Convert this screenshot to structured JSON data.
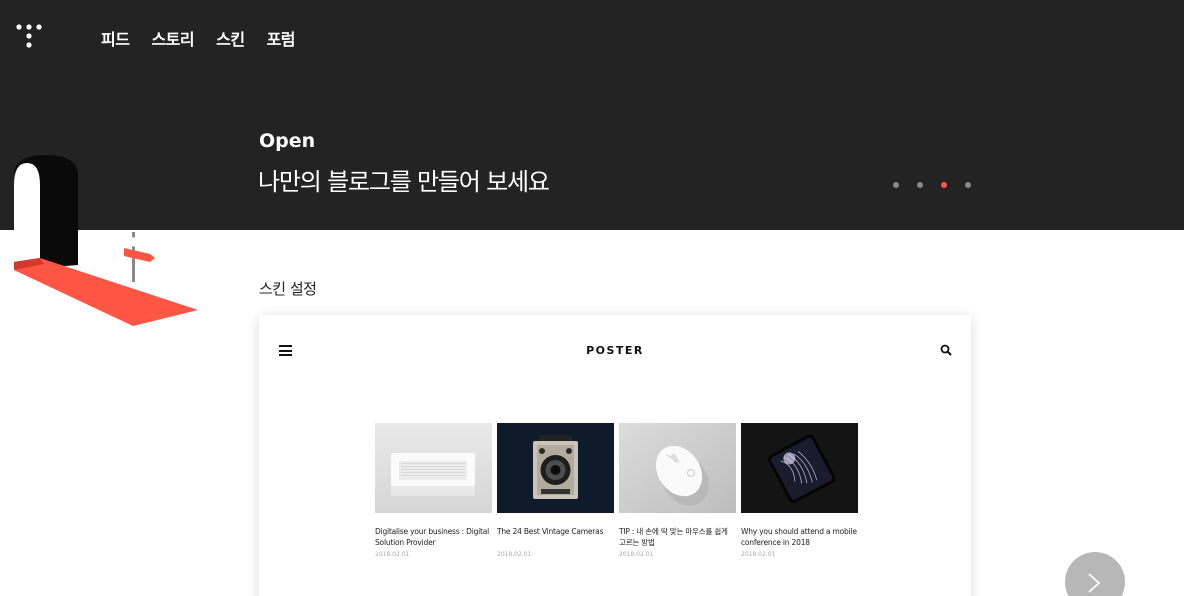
{
  "nav": {
    "logo_icon": "tistory-dots-logo",
    "items": [
      {
        "label": "피드"
      },
      {
        "label": "스토리"
      },
      {
        "label": "스킨"
      },
      {
        "label": "포럼"
      }
    ]
  },
  "hero": {
    "eyebrow": "Open",
    "title": "나만의 블로그를 만들어 보세요",
    "illustration": "door-with-signpost",
    "slides_total": 4,
    "active_slide": 3
  },
  "skin_section": {
    "label": "스킨 설정",
    "preview": {
      "menu_icon": "hamburger-menu-icon",
      "title": "POSTER",
      "search_icon": "search-icon",
      "posts": [
        {
          "title": "Digitalise your business : Digital Solution Provider",
          "date": "2018.02.01",
          "image": "white-speaker"
        },
        {
          "title": "The 24 Best Vintage Cameras",
          "date": "2018.02.01",
          "image": "vintage-camera"
        },
        {
          "title": "TIP : 내 손에 딱 맞는 마우스를 쉽게 고르는 방법",
          "date": "2018.02.01",
          "image": "white-mouse"
        },
        {
          "title": "Why you should attend a mobile conference in 2018",
          "date": "2018.02.01",
          "image": "smartphone"
        }
      ]
    }
  },
  "next_button_icon": "chevron-right-icon",
  "colors": {
    "header_bg": "#232323",
    "accent": "#ff5544",
    "dot_inactive": "#8a8a8a",
    "next_button": "#b7b7b7"
  }
}
